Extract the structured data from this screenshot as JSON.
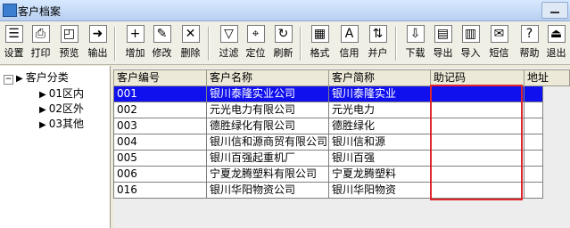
{
  "window": {
    "title": "客户档案"
  },
  "toolbar": [
    {
      "label": "设置",
      "icon": "settings-icon",
      "glyph": "☰"
    },
    {
      "label": "打印",
      "icon": "printer-icon",
      "glyph": "⎙"
    },
    {
      "label": "预览",
      "icon": "preview-icon",
      "glyph": "◰"
    },
    {
      "label": "输出",
      "icon": "export-icon",
      "glyph": "➜"
    },
    {
      "label": "增加",
      "icon": "add-icon",
      "glyph": "+"
    },
    {
      "label": "修改",
      "icon": "edit-icon",
      "glyph": "✎"
    },
    {
      "label": "删除",
      "icon": "delete-icon",
      "glyph": "✕"
    },
    {
      "label": "过滤",
      "icon": "filter-icon",
      "glyph": "▽"
    },
    {
      "label": "定位",
      "icon": "locate-icon",
      "glyph": "⌖"
    },
    {
      "label": "刷新",
      "icon": "refresh-icon",
      "glyph": "↻"
    },
    {
      "label": "格式",
      "icon": "format-icon",
      "glyph": "▦"
    },
    {
      "label": "信用",
      "icon": "credit-icon",
      "glyph": "A"
    },
    {
      "label": "并户",
      "icon": "merge-icon",
      "glyph": "⇅"
    },
    {
      "label": "下载",
      "icon": "download-icon",
      "glyph": "⇩"
    },
    {
      "label": "导出",
      "icon": "export-doc-icon",
      "glyph": "▤"
    },
    {
      "label": "导入",
      "icon": "import-icon",
      "glyph": "▥"
    },
    {
      "label": "短信",
      "icon": "sms-icon",
      "glyph": "✉"
    },
    {
      "label": "帮助",
      "icon": "help-icon",
      "glyph": "?"
    },
    {
      "label": "退出",
      "icon": "exit-icon",
      "glyph": "⏏"
    }
  ],
  "tree": {
    "root": "客户分类",
    "items": [
      "01区内",
      "02区外",
      "03其他"
    ]
  },
  "table": {
    "columns": [
      "客户编号",
      "客户名称",
      "客户简称",
      "助记码",
      "地址"
    ],
    "rows": [
      [
        "001",
        "银川泰隆实业公司",
        "银川泰隆实业",
        "",
        ""
      ],
      [
        "002",
        "元光电力有限公司",
        "元光电力",
        "",
        ""
      ],
      [
        "003",
        "德胜绿化有限公司",
        "德胜绿化",
        "",
        ""
      ],
      [
        "004",
        "银川信和源商贸有限公司",
        "银川信和源",
        "",
        ""
      ],
      [
        "005",
        "银川百强起重机厂",
        "银川百强",
        "",
        ""
      ],
      [
        "006",
        "宁夏龙腾塑料有限公司",
        "宁夏龙腾塑料",
        "",
        ""
      ],
      [
        "016",
        "银川华阳物资公司",
        "银川华阳物资",
        "",
        ""
      ]
    ],
    "selected_row": 0
  },
  "colors": {
    "selection": "#1010ee",
    "highlight_box": "#e0262c"
  }
}
